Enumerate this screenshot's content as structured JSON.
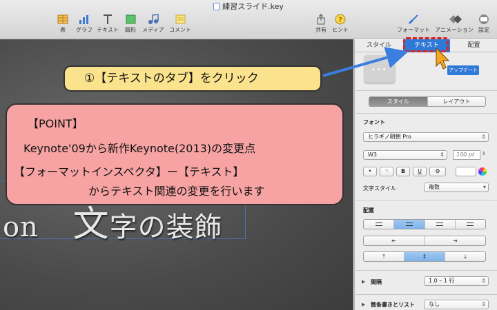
{
  "window": {
    "title": "練習スライド.key"
  },
  "toolbar": {
    "left": [
      {
        "label": "表",
        "icon": "table-icon"
      },
      {
        "label": "グラフ",
        "icon": "chart-icon"
      },
      {
        "label": "テキスト",
        "icon": "text-icon"
      },
      {
        "label": "図形",
        "icon": "shape-icon"
      },
      {
        "label": "メディア",
        "icon": "media-icon"
      },
      {
        "label": "コメント",
        "icon": "comment-icon"
      }
    ],
    "share": "共有",
    "tips": "ヒント",
    "format": "フォーマット",
    "animate": "アニメーション",
    "settings": "設定"
  },
  "slide": {
    "text_big": "文",
    "text_small": "字の装飾",
    "text_prefix": "on"
  },
  "callouts": {
    "tab": "①【テキストのタブ】をクリック",
    "point_title": "【POINT】",
    "point_line1": "Keynote'09から新作Keynote(2013)の変更点",
    "point_line2": "【フォーマットインスペクタ】ー【テキスト】",
    "point_line3": "からテキスト関連の変更を行います"
  },
  "inspector": {
    "tabs": [
      "スタイル",
      "テキスト",
      "配置"
    ],
    "active_tab": "テキスト",
    "update_button": "アップデート",
    "sub_tabs": [
      "スタイル",
      "レイアウト"
    ],
    "font_label": "フォント",
    "font_name": "ヒラギノ明朝 Pro",
    "font_weight": "W3",
    "font_size": "100 pt",
    "format_buttons": [
      "•",
      "◝",
      "B",
      "U",
      "⚙"
    ],
    "char_style_label": "文字スタイル",
    "char_style_value": "複数",
    "align_label": "配置",
    "spacing_label": "間隔",
    "spacing_value": "1.0 – 1 行",
    "bullets_label": "箇条書きとリスト",
    "bullets_value": "なし"
  },
  "colors": {
    "accent": "#2f79d8",
    "callout_yellow": "#fbe38d",
    "callout_pink": "#f7a3a3",
    "highlight_red": "#e0201b"
  }
}
